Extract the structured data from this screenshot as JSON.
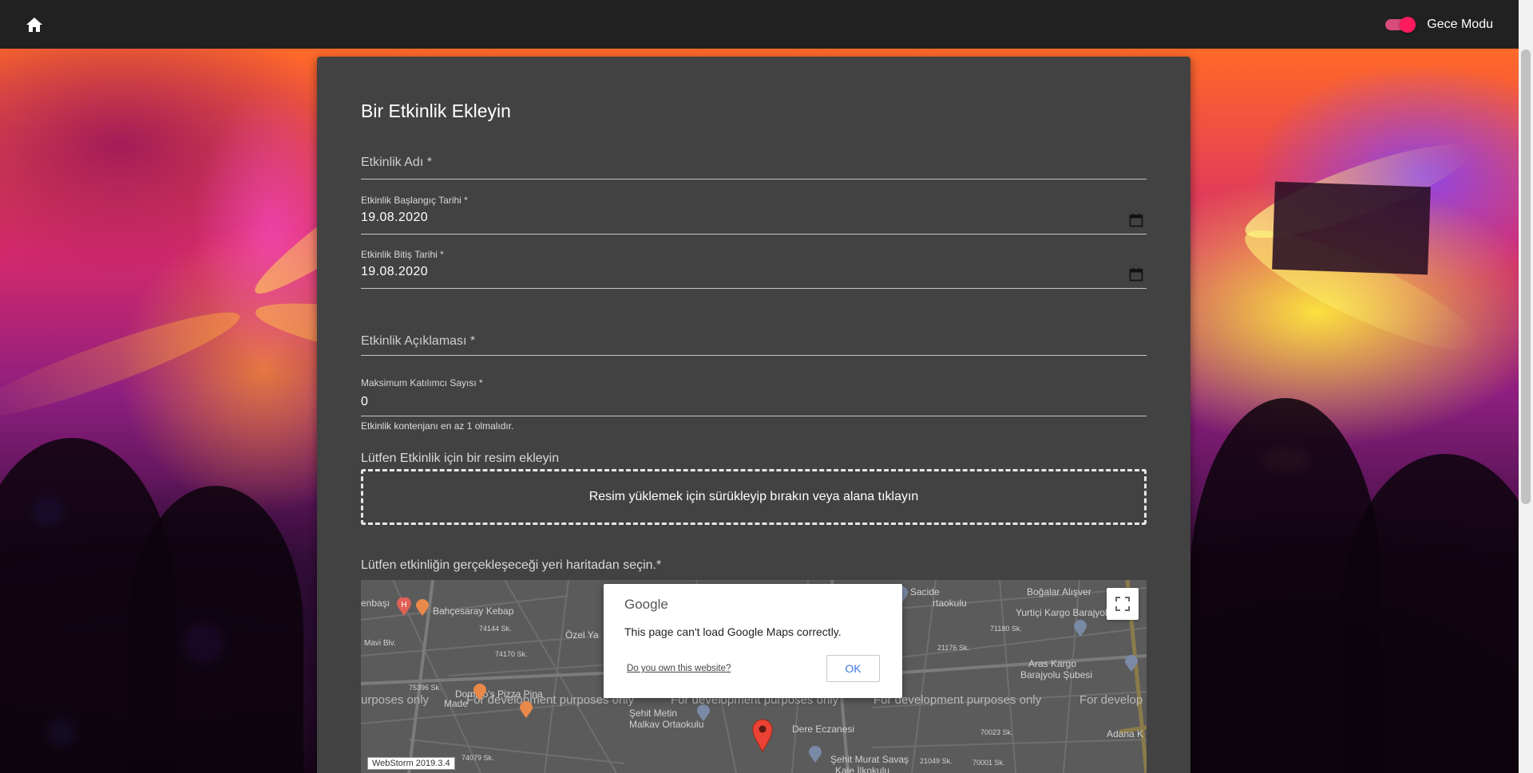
{
  "topbar": {
    "home_icon": "home-icon",
    "night_mode_label": "Gece Modu",
    "night_mode_on": true,
    "accent": "#ff1a5e"
  },
  "form": {
    "title": "Bir Etkinlik Ekleyin",
    "event_name": {
      "label": "Etkinlik Adı *",
      "value": ""
    },
    "start_date": {
      "label": "Etkinlik Başlangıç Tarihi *",
      "value": "19.08.2020",
      "icon": "calendar-icon"
    },
    "end_date": {
      "label": "Etkinlik Bitiş Tarihi *",
      "value": "19.08.2020",
      "icon": "calendar-icon"
    },
    "description": {
      "label": "Etkinlik Açıklaması *",
      "value": ""
    },
    "max_participants": {
      "label": "Maksimum Katılımcı Sayısı *",
      "value": "0",
      "hint": "Etkinlik kontenjanı en az 1 olmalıdır."
    },
    "image": {
      "label": "Lütfen Etkinlik için bir resim ekleyin",
      "dropzone_text": "Resim yüklemek için sürükleyip bırakın veya alana tıklayın"
    },
    "location_label": "Lütfen etkinliğin gerçekleşeceği yeri haritadan seçin.*"
  },
  "map": {
    "dev_watermark": "For development purposes only",
    "dev_watermark_cut_left": "urposes only",
    "dev_watermark_cut_right": "For develop",
    "places": {
      "p1": "enbaşı",
      "p2": "Bahçesaray Kebap",
      "p3": "Özel Ya",
      "p4": "Mavi Blv.",
      "p5": "Domino's Pizza Pina",
      "p6": "Made",
      "p7": "Şehit Metin",
      "p8": "Malkav Ortaokulu",
      "p9": "Dere Eczanesi",
      "p10": "Şehit Murat Savaş",
      "p11": "Kale İlkokulu",
      "p12": "Sacide",
      "p13": "rtaokulu",
      "p14": "Boğalar Alışver",
      "p15": "Yurtiçi Kargo Barajyolu",
      "p16": "Aras Kargo",
      "p17": "Barajyolu Şubesi",
      "p18": "Adana K",
      "p19": "74144 Sk.",
      "p20": "74170 Sk.",
      "p21": "75396 Sk.",
      "p22": "74079 Sk.",
      "p23": "71180 Sk.",
      "p24": "21176 Sk.",
      "p25": "70023 Sk.",
      "p26": "70001 Sk.",
      "p27": "21049 Sk."
    },
    "fullscreen_icon": "fullscreen-icon",
    "pin_icon": "map-pin-icon",
    "badge": "WebStorm 2019.3.4"
  },
  "map_error_dialog": {
    "logo": "Google",
    "message": "This page can't load Google Maps correctly.",
    "link": "Do you own this website?",
    "ok_label": "OK"
  }
}
